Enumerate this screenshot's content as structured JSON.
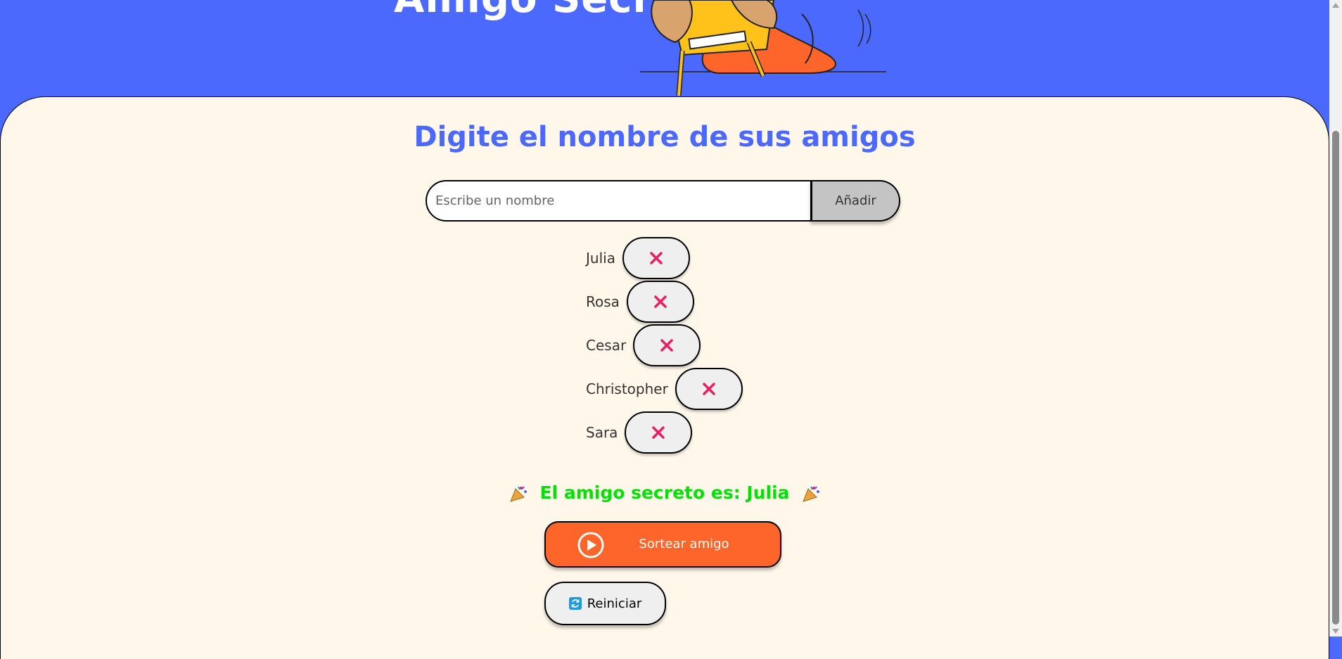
{
  "header": {
    "title": "Amigo Secreto",
    "illustration_icon": "person-holding-present-illustration"
  },
  "main": {
    "title": "Digite el nombre de sus amigos",
    "input": {
      "placeholder": "Escribe un nombre",
      "value": ""
    },
    "add_button_label": "Añadir",
    "friends": [
      {
        "name": "Julia"
      },
      {
        "name": "Rosa"
      },
      {
        "name": "Cesar"
      },
      {
        "name": "Christopher"
      },
      {
        "name": "Sara"
      }
    ],
    "remove_icon": "close-icon",
    "result": {
      "text": "El amigo secreto es: Julia",
      "icon": "party-popper-icon"
    },
    "draw_button_label": "Sortear amigo",
    "reset_button_label": "Reiniciar"
  },
  "colors": {
    "header_bg": "#4B69FD",
    "card_bg": "#FFF7EA",
    "title": "#4B69FD",
    "result": "#05DF05",
    "draw_button": "#FE652B",
    "remove_x": "#E91E63"
  }
}
